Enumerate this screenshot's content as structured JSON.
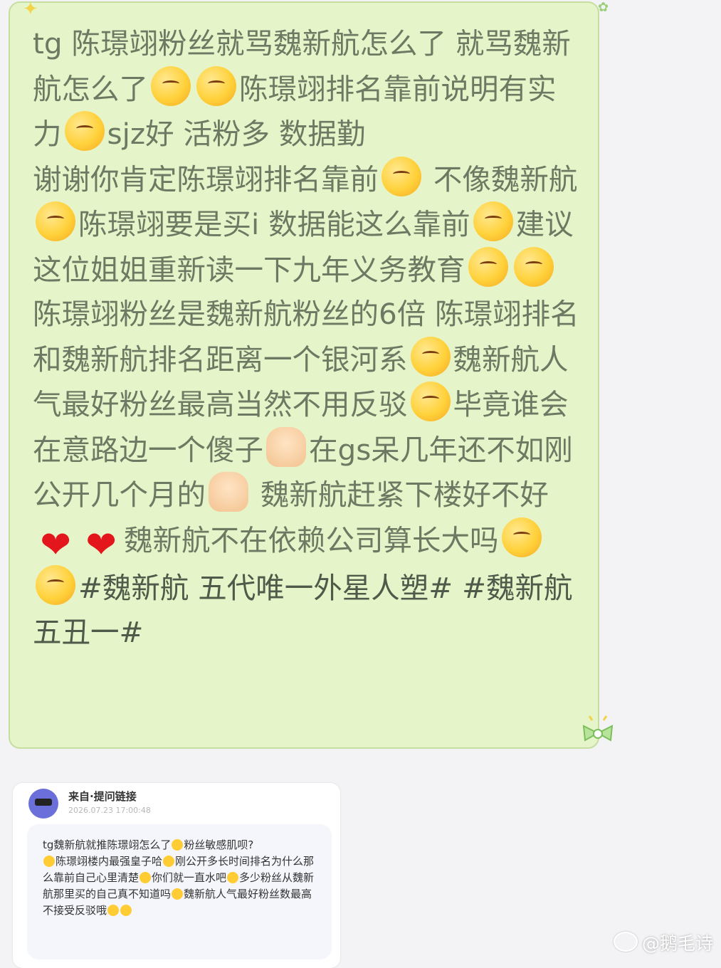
{
  "message": {
    "segments": [
      "tg 陈璟翊粉丝就骂魏新航怎么了 就骂魏新航怎么了",
      "陈璟翊排名靠前说明有实力",
      "sjz好 活粉多 数据勤",
      "谢谢你肯定陈璟翊排名靠前",
      " 不像魏新航",
      "陈璟翊要是买ⅰ 数据能这么靠前",
      "建议这位姐姐重新读一下九年义务教育",
      "陈璟翊粉丝是魏新航粉丝的6倍 陈璟翊排名和魏新航排名距离一个银河系",
      "魏新航人气最好粉丝最高当然不用反驳",
      "毕竟谁会在意路边一个傻子",
      "在gs呆几年还不如刚公开几个月的",
      " 魏新航赶紧下楼好不好",
      "魏新航不在依赖公司算长大吗",
      "#魏新航 五代唯一外星人塑# #魏新航 五丑一#"
    ]
  },
  "card": {
    "title": "来自·提问链接",
    "time": "2026.07.23 17:00:48",
    "segments": [
      "tg魏新航就推陈璟翊怎么了",
      "粉丝敏感肌呗?",
      "陈璟翊楼内最强皇子哈",
      "刚公开多长时间排名为什么那么靠前自己心里清楚",
      "你们就一直水吧",
      "多少粉丝从魏新航那里买的自己真不知道吗",
      "魏新航人气最好粉丝数最高不接受反驳哦"
    ]
  },
  "watermark": "@鹅毛诗",
  "icons": {
    "emoji": "emoji-face-icon",
    "heart": "red-heart-icon",
    "hand": "hand-gesture-icon"
  }
}
